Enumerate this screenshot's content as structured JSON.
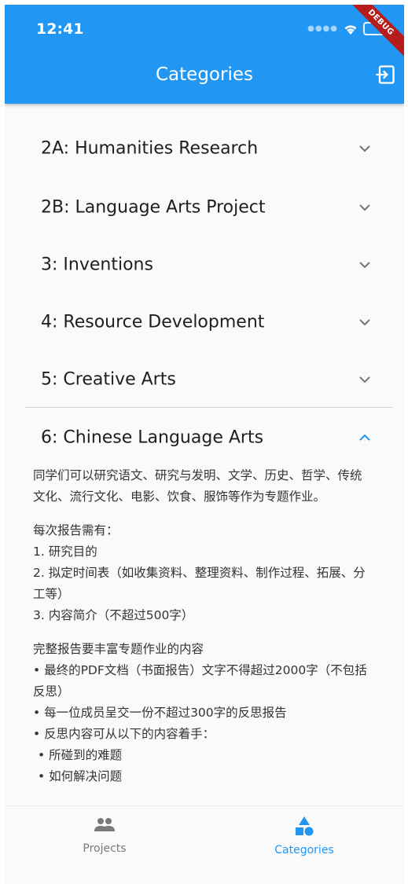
{
  "status": {
    "time": "12:41"
  },
  "appbar": {
    "title": "Categories",
    "debug_label": "DEBUG"
  },
  "categories": [
    {
      "label": "2A: Humanities Research"
    },
    {
      "label": "2B: Language Arts Project"
    },
    {
      "label": "3: Inventions"
    },
    {
      "label": "4: Resource Development"
    },
    {
      "label": "5: Creative Arts"
    }
  ],
  "expanded": {
    "label": "6: Chinese Language Arts",
    "intro": "同学们可以研究语文、研究与发明、文学、历史、哲学、传统文化、流行文化、电影、饮食、服饰等作为专题作业。",
    "report_title": "每次报告需有：",
    "report_items": [
      "1. 研究目的",
      "2. 拟定时间表（如收集资料、整理资料、制作过程、拓展、分工等）",
      "3. 内容简介（不超过500字）"
    ],
    "full_title": "完整报告要丰富专题作业的内容",
    "full_items": [
      "• 最终的PDF文档（书面报告）文字不得超过2000字（不包括反思）",
      "• 每一位成员呈交一份不超过300字的反思报告",
      "• 反思内容可从以下的内容着手："
    ],
    "sub_items": [
      "• 所碰到的难题",
      "• 如何解决问题"
    ]
  },
  "bottom_nav": {
    "projects_label": "Projects",
    "categories_label": "Categories",
    "active": "Categories"
  },
  "colors": {
    "primary": "#2196f3",
    "debug_banner": "#b71c1c"
  }
}
